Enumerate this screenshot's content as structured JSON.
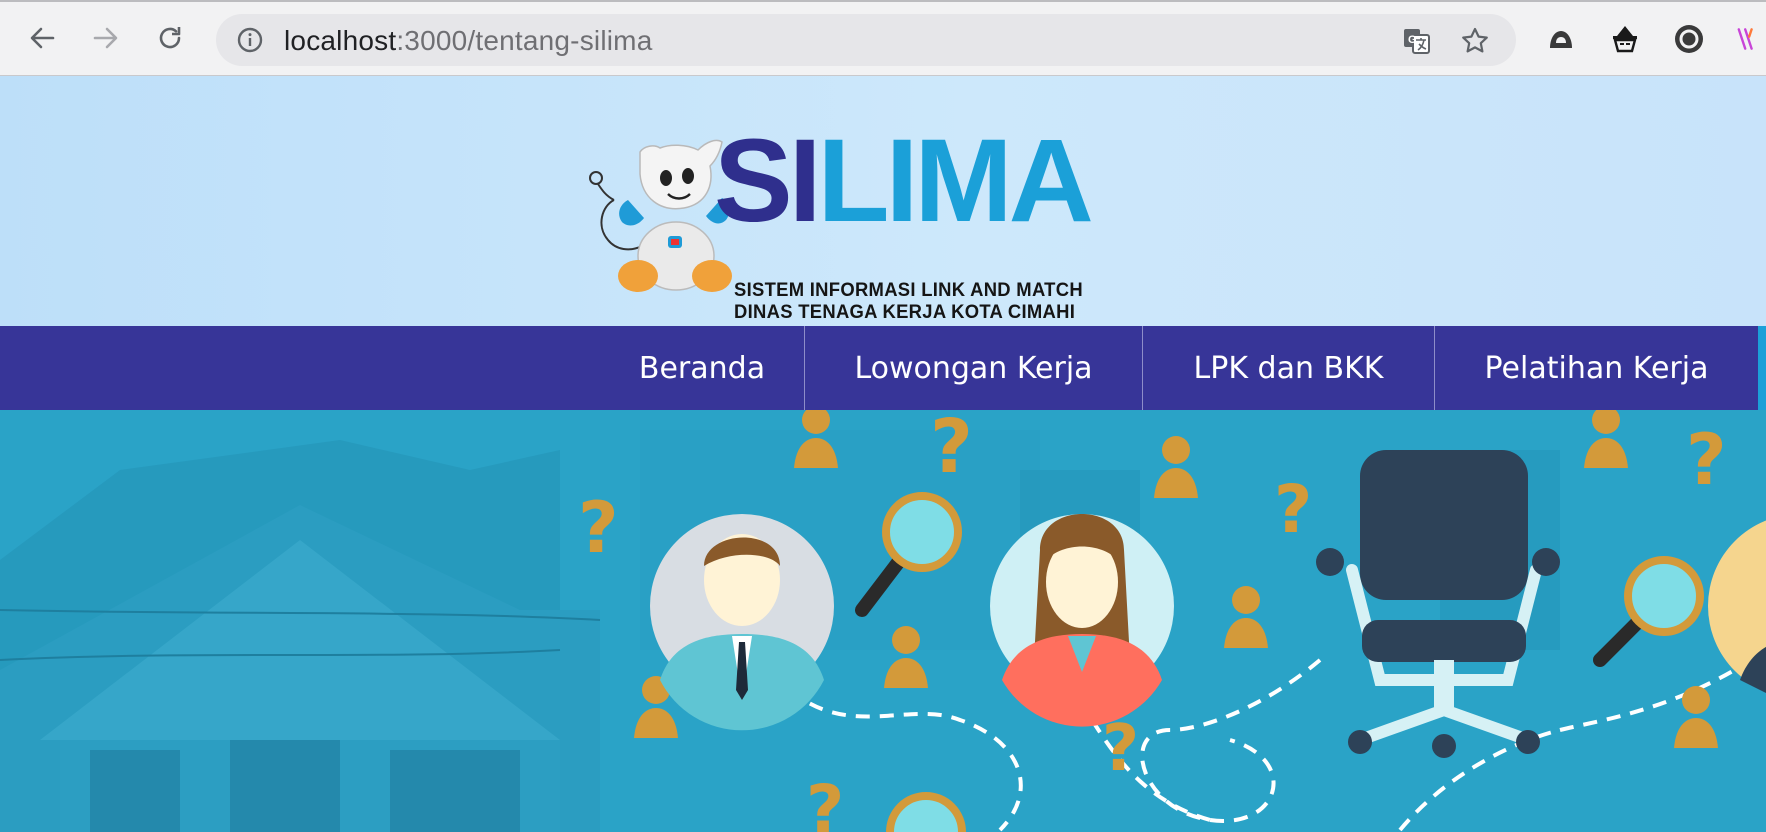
{
  "browser": {
    "url_host": "localhost",
    "url_path": ":3000/tentang-silima",
    "icons": {
      "back": "back-arrow-icon",
      "forward": "forward-arrow-icon",
      "reload": "reload-icon",
      "info": "info-icon",
      "translate": "translate-icon",
      "bookmark": "star-icon"
    },
    "extensions": [
      "hood-extension-icon",
      "incognito-extension-icon",
      "circle-extension-icon",
      "partial-extension-icon"
    ]
  },
  "header": {
    "logo_part1": "SI",
    "logo_part2": "LIMA",
    "logo_line1": "SISTEM INFORMASI LINK AND MATCH",
    "logo_line2": "DINAS TENAGA KERJA KOTA CIMAHI"
  },
  "nav": {
    "items": [
      {
        "label": "Beranda"
      },
      {
        "label": "Lowongan Kerja"
      },
      {
        "label": "LPK dan BKK"
      },
      {
        "label": "Pelatihan Kerja"
      }
    ]
  },
  "hero": {
    "illustration": "job-search-illustration",
    "question_mark": "?"
  },
  "colors": {
    "nav_bg": "#373598",
    "logo_si": "#2f2f8d",
    "logo_lima": "#1ba0d8",
    "hero_bg": "#2aa3c7",
    "accent_gold": "#d39a3a"
  }
}
